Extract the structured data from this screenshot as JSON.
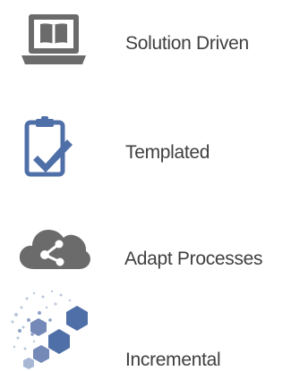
{
  "features": [
    {
      "label": "Solution Driven",
      "icon": "laptop-book-icon"
    },
    {
      "label": "Templated",
      "icon": "clipboard-check-icon"
    },
    {
      "label": "Adapt Processes",
      "icon": "cloud-share-icon"
    },
    {
      "label": "Incremental",
      "icon": "hexagon-cluster-icon"
    }
  ],
  "colors": {
    "icon_gray": "#6b6b6b",
    "icon_blue": "#4f6fa8",
    "text": "#3f3f3f"
  }
}
